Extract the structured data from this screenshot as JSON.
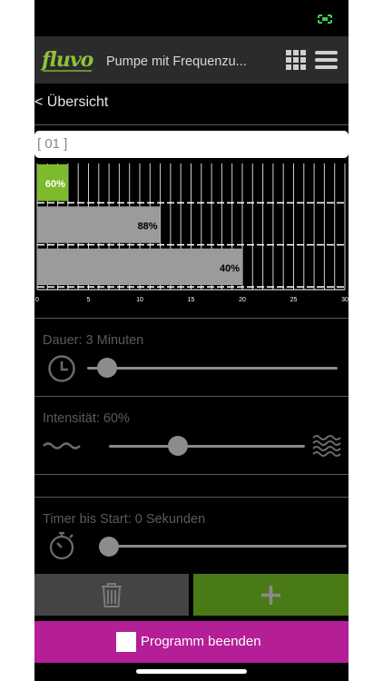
{
  "app": {
    "header_title": "Pumpe mit Frequenzu...",
    "logo_text": "fluvo",
    "brand_color": "#8fc23a"
  },
  "nav": {
    "back_label": "< Übersicht"
  },
  "program": {
    "name_value": "[ 01 ]"
  },
  "chart_data": {
    "type": "bar",
    "orientation": "horizontal",
    "bars": [
      {
        "start": 0,
        "end": 3,
        "label": "60%",
        "color": "#7dba2c",
        "label_color": "#ffffff"
      },
      {
        "start": 0,
        "end": 12,
        "label": "88%",
        "color": "#9b9b9b",
        "label_color": "#000000"
      },
      {
        "start": 0,
        "end": 20,
        "label": "40%",
        "color": "#9b9b9b",
        "label_color": "#000000"
      }
    ],
    "x_ticks": [
      "0",
      "5",
      "10",
      "15",
      "20",
      "25",
      "30"
    ],
    "xlim": [
      0,
      30
    ],
    "grid": true
  },
  "settings": {
    "duration": {
      "label": "Dauer: 3 Minuten",
      "value_fraction": 0.08,
      "icon": "clock-icon"
    },
    "intensity": {
      "label": "Intensität: 60%",
      "value_fraction": 0.35,
      "icon_low": "wave-low-icon",
      "icon_high": "wave-high-icon"
    },
    "timer": {
      "label": "Timer bis Start: 0 Sekunden",
      "value_fraction": 0.0,
      "icon": "stopwatch-icon"
    }
  },
  "actions": {
    "delete_icon": "trash-icon",
    "add_icon": "plus-icon",
    "end_program_label": "Programm beenden"
  }
}
